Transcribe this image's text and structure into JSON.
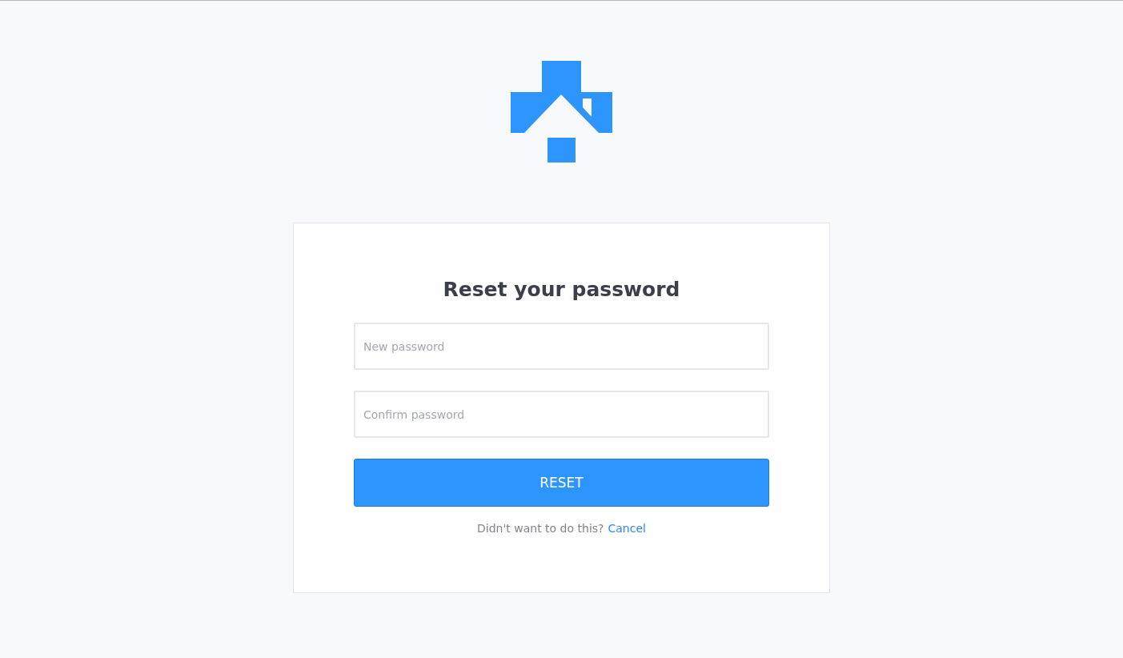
{
  "title": "Reset your password",
  "fields": [
    {
      "placeholder": "New password"
    },
    {
      "placeholder": "Confirm password"
    }
  ],
  "button": "RESET",
  "footer": {
    "text": "Didn't want to do this?",
    "link": "Cancel"
  }
}
